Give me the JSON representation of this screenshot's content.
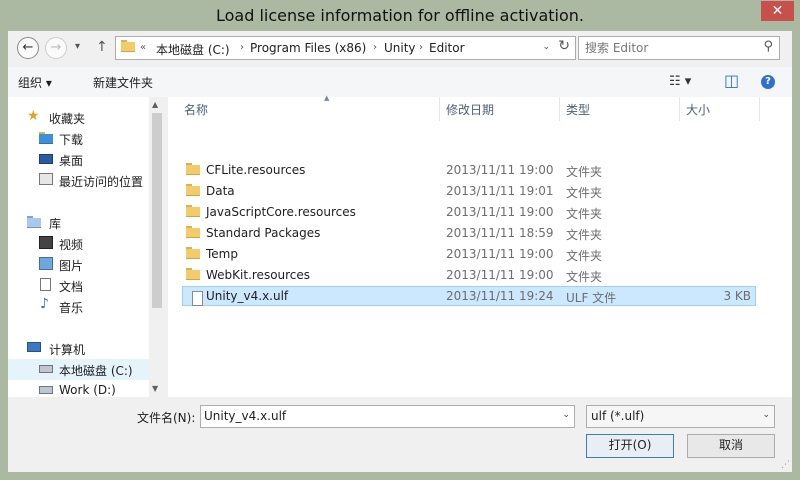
{
  "window": {
    "title": "Load license information for offline activation.",
    "close_glyph": "✕"
  },
  "nav": {
    "back_glyph": "←",
    "forward_glyph": "→",
    "recent_glyph": "▾",
    "up_glyph": "↑"
  },
  "address": {
    "prefix": "«",
    "crumbs": [
      "本地磁盘 (C:)",
      "Program Files (x86)",
      "Unity",
      "Editor"
    ],
    "separator": "›",
    "dropdown_glyph": "⌄",
    "refresh_glyph": "↻"
  },
  "search": {
    "placeholder": "搜索 Editor",
    "icon_glyph": "⚲"
  },
  "toolbar": {
    "organize_label": "组织 ▾",
    "new_folder_label": "新建文件夹",
    "view_glyph": "☷ ▾",
    "preview_glyph": "◫",
    "help_glyph": "?"
  },
  "sidebar": {
    "groups": [
      {
        "label": "收藏夹",
        "icon": "star-icon"
      },
      {
        "label": "下载",
        "icon": "download-folder-icon"
      },
      {
        "label": "桌面",
        "icon": "desktop-icon"
      },
      {
        "label": "最近访问的位置",
        "icon": "recent-places-icon"
      },
      {
        "label": "库",
        "icon": "library-icon"
      },
      {
        "label": "视频",
        "icon": "video-icon"
      },
      {
        "label": "图片",
        "icon": "picture-icon"
      },
      {
        "label": "文档",
        "icon": "document-icon"
      },
      {
        "label": "音乐",
        "icon": "music-icon"
      },
      {
        "label": "计算机",
        "icon": "computer-icon"
      },
      {
        "label": "本地磁盘 (C:)",
        "icon": "drive-icon"
      },
      {
        "label": "Work (D:)",
        "icon": "drive-icon"
      }
    ],
    "scroll_up_glyph": "▲",
    "scroll_down_glyph": "▼"
  },
  "filelist": {
    "columns": [
      "名称",
      "修改日期",
      "类型",
      "大小"
    ],
    "sort_glyph": "▲",
    "rows": [
      {
        "name": "CFLite.resources",
        "date": "2013/11/11 19:00",
        "type": "文件夹",
        "size": "",
        "kind": "folder"
      },
      {
        "name": "Data",
        "date": "2013/11/11 19:01",
        "type": "文件夹",
        "size": "",
        "kind": "folder"
      },
      {
        "name": "JavaScriptCore.resources",
        "date": "2013/11/11 19:00",
        "type": "文件夹",
        "size": "",
        "kind": "folder"
      },
      {
        "name": "Standard Packages",
        "date": "2013/11/11 18:59",
        "type": "文件夹",
        "size": "",
        "kind": "folder"
      },
      {
        "name": "Temp",
        "date": "2013/11/11 19:00",
        "type": "文件夹",
        "size": "",
        "kind": "folder"
      },
      {
        "name": "WebKit.resources",
        "date": "2013/11/11 19:00",
        "type": "文件夹",
        "size": "",
        "kind": "folder"
      },
      {
        "name": "Unity_v4.x.ulf",
        "date": "2013/11/11 19:24",
        "type": "ULF 文件",
        "size": "3 KB",
        "kind": "file",
        "selected": true
      }
    ]
  },
  "footer": {
    "filename_label": "文件名(N):",
    "filename_value": "Unity_v4.x.ulf",
    "dropdown_glyph": "⌄",
    "filter_value": "ulf (*.ulf)",
    "open_label": "打开(O)",
    "cancel_label": "取消",
    "grip_glyph": "⋰"
  }
}
